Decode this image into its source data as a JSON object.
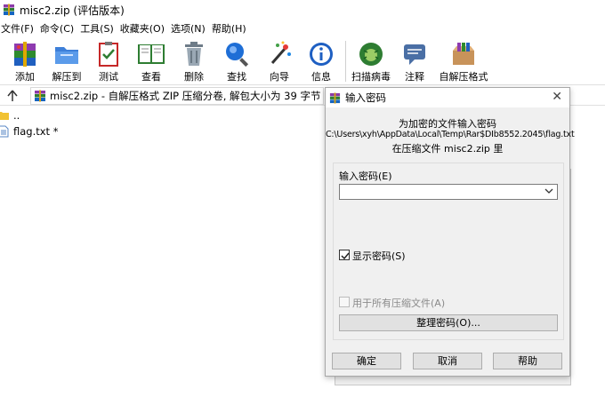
{
  "window": {
    "title": "misc2.zip (评估版本)"
  },
  "menu": [
    "文件(F)",
    "命令(C)",
    "工具(S)",
    "收藏夹(O)",
    "选项(N)",
    "帮助(H)"
  ],
  "toolbar": {
    "add": "添加",
    "extract_to": "解压到",
    "test": "测试",
    "view": "查看",
    "delete": "删除",
    "find": "查找",
    "wizard": "向导",
    "info": "信息",
    "virus_scan": "扫描病毒",
    "comment": "注释",
    "sfx": "自解压格式"
  },
  "address": {
    "text": "misc2.zip - 自解压格式 ZIP 压缩分卷, 解包大小为 39 字节"
  },
  "files": [
    {
      "name": "..",
      "icon": "folder-icon"
    },
    {
      "name": "flag.txt *",
      "icon": "text-file-icon"
    }
  ],
  "dialog": {
    "title": "输入密码",
    "line1": "为加密的文件输入密码",
    "line2": "C:\\Users\\xyh\\AppData\\Local\\Temp\\Rar$DIb8552.2045\\flag.txt",
    "line3": "在压缩文件 misc2.zip 里",
    "password_label": "输入密码(E)",
    "password_value": "",
    "show_password": "显示密码(S)",
    "show_password_checked": true,
    "use_for_all": "用于所有压缩文件(A)",
    "use_for_all_checked": false,
    "organize": "整理密码(O)...",
    "ok": "确定",
    "cancel": "取消",
    "help": "帮助"
  }
}
